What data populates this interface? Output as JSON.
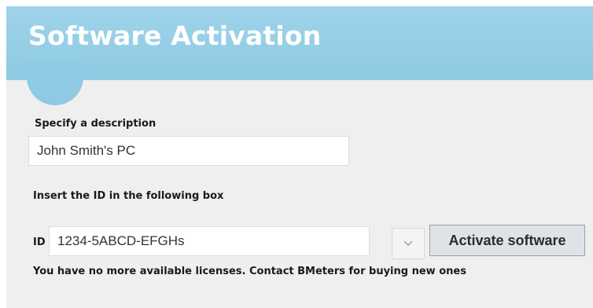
{
  "window": {
    "title": "Software Activation"
  },
  "form": {
    "description_label": "Specify a description",
    "description_value": "John Smith's PC",
    "id_instruction": "Insert the ID in the following box",
    "id_label": "ID",
    "id_value": "1234-5ABCD-EFGHs",
    "activate_label": "Activate software",
    "license_message": "You have no more available licenses. Contact BMeters for buying new ones"
  },
  "icons": {
    "dropdown": "chevron-down-icon"
  },
  "colors": {
    "header": "#8ecae3",
    "background": "#efefef",
    "button": "#dfe3e7"
  }
}
